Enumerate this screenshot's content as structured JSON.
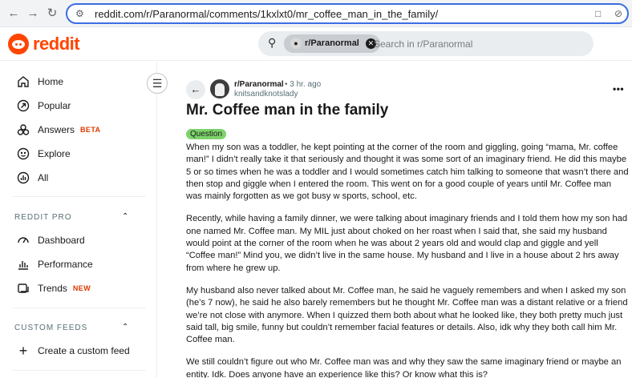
{
  "browser": {
    "url": "reddit.com/r/Paranormal/comments/1kxlxt0/mr_coffee_man_in_the_family/"
  },
  "header": {
    "logo_text": "reddit",
    "search": {
      "chip_label": "r/Paranormal",
      "placeholder": "Search in r/Paranormal"
    }
  },
  "sidebar": {
    "nav": [
      {
        "label": "Home",
        "icon": "home-icon"
      },
      {
        "label": "Popular",
        "icon": "popular-icon"
      },
      {
        "label": "Answers",
        "badge": "BETA",
        "icon": "answers-icon"
      },
      {
        "label": "Explore",
        "icon": "explore-icon"
      },
      {
        "label": "All",
        "icon": "all-icon"
      }
    ],
    "reddit_pro": {
      "heading": "REDDIT PRO",
      "items": [
        {
          "label": "Dashboard",
          "icon": "dashboard-icon"
        },
        {
          "label": "Performance",
          "icon": "performance-icon"
        },
        {
          "label": "Trends",
          "badge": "NEW",
          "icon": "trends-icon"
        }
      ]
    },
    "custom_feeds": {
      "heading": "CUSTOM FEEDS",
      "create_label": "Create a custom feed"
    }
  },
  "post": {
    "subreddit": "r/Paranormal",
    "time": "• 3 hr. ago",
    "author": "knitsandknotslady",
    "title": "Mr. Coffee man in the family",
    "flair": "Question",
    "paragraphs": [
      "When my son was a toddler, he kept pointing at the corner of the room and giggling, going “mama, Mr. coffee man!” I didn’t really take it that seriously and thought it was some sort of an imaginary friend. He did this maybe 5 or so times when he was a toddler and I would sometimes catch him talking to someone that wasn’t there and then stop and giggle when I entered the room. This went on for a good couple of years until Mr. Coffee man was mainly forgotten as we got busy w sports, school, etc.",
      "Recently, while having a family dinner, we were talking about imaginary friends and I told them how my son had one named Mr. Coffee man. My MIL just about choked on her roast when I said that, she said my husband would point at the corner of the room when he was about 2 years old and would clap and giggle and yell “Coffee man!” Mind you, we didn’t live in the same house. My husband and I live in a house about 2 hrs away from where he grew up.",
      "My husband also never talked about Mr. Coffee man, he said he vaguely remembers and when I asked my son (he’s 7 now), he said he also barely remembers but he thought Mr. Coffee man was a distant relative or a friend we’re not close with anymore. When I quizzed them both about what he looked like, they both pretty much just said tall, big smile, funny but couldn’t remember facial features or details. Also, idk why they both call him Mr. Coffee man.",
      "We still couldn’t figure out who Mr. Coffee man was and why they saw the same imaginary friend or maybe an entity. Idk. Does anyone have an experience like this? Or know what this is?"
    ]
  }
}
